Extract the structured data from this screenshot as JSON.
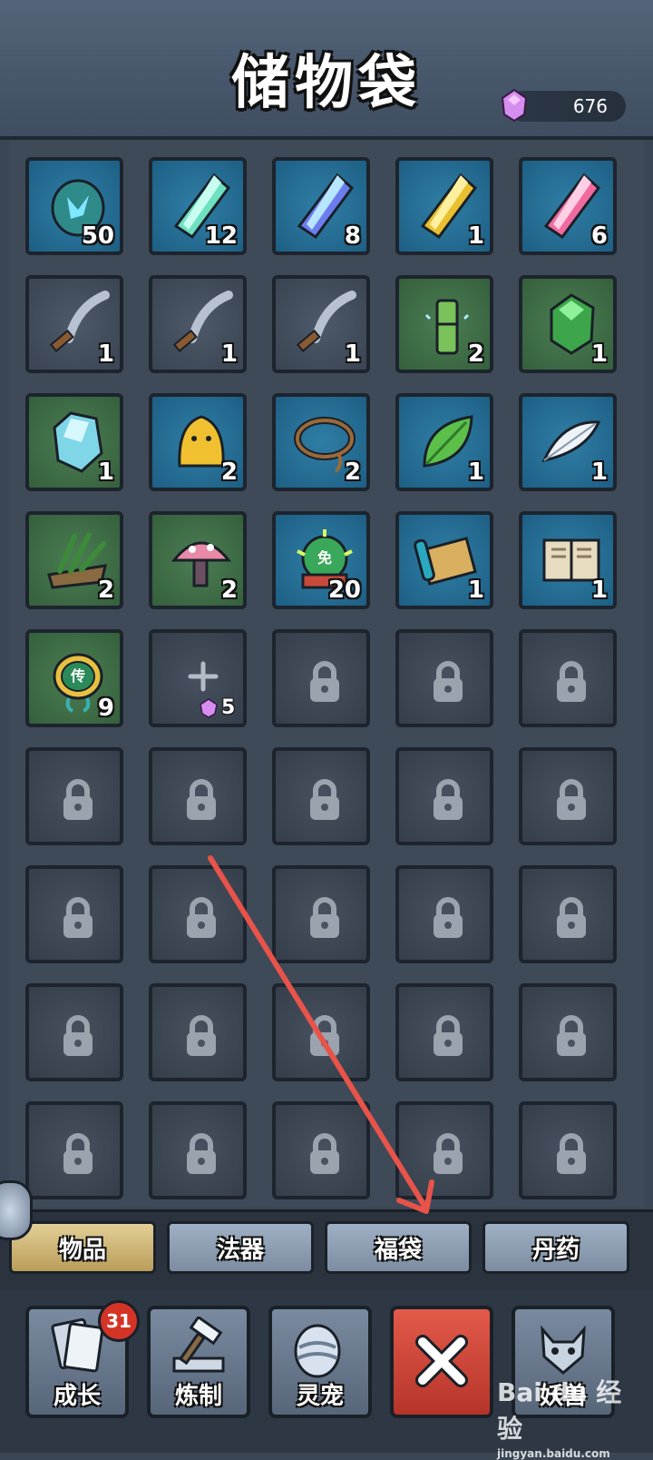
{
  "header": {
    "title": "储物袋",
    "currency_value": "676",
    "currency_icon": "purple-gem-icon"
  },
  "slots": [
    {
      "row": 0,
      "col": 0,
      "bg": "blue",
      "icon": "spirit-stone-icon",
      "count": "50"
    },
    {
      "row": 0,
      "col": 1,
      "bg": "blue",
      "icon": "green-crystal-icon",
      "count": "12"
    },
    {
      "row": 0,
      "col": 2,
      "bg": "blue",
      "icon": "blue-crystal-icon",
      "count": "8"
    },
    {
      "row": 0,
      "col": 3,
      "bg": "blue",
      "icon": "gold-crystal-icon",
      "count": "1"
    },
    {
      "row": 0,
      "col": 4,
      "bg": "blue",
      "icon": "pink-crystal-icon",
      "count": "6"
    },
    {
      "row": 1,
      "col": 0,
      "bg": "gray",
      "icon": "sickle-icon",
      "count": "1"
    },
    {
      "row": 1,
      "col": 1,
      "bg": "gray",
      "icon": "sickle-icon",
      "count": "1"
    },
    {
      "row": 1,
      "col": 2,
      "bg": "gray",
      "icon": "sickle-icon",
      "count": "1"
    },
    {
      "row": 1,
      "col": 3,
      "bg": "green",
      "icon": "bamboo-icon",
      "count": "2"
    },
    {
      "row": 1,
      "col": 4,
      "bg": "green",
      "icon": "jade-stone-icon",
      "count": "1"
    },
    {
      "row": 2,
      "col": 0,
      "bg": "green",
      "icon": "ice-stone-icon",
      "count": "1"
    },
    {
      "row": 2,
      "col": 1,
      "bg": "blue",
      "icon": "yellow-slime-icon",
      "count": "2"
    },
    {
      "row": 2,
      "col": 2,
      "bg": "blue",
      "icon": "rope-icon",
      "count": "2"
    },
    {
      "row": 2,
      "col": 3,
      "bg": "blue",
      "icon": "leaf-icon",
      "count": "1"
    },
    {
      "row": 2,
      "col": 4,
      "bg": "blue",
      "icon": "feather-icon",
      "count": "1"
    },
    {
      "row": 3,
      "col": 0,
      "bg": "green",
      "icon": "herb-bundle-icon",
      "count": "2"
    },
    {
      "row": 3,
      "col": 1,
      "bg": "green",
      "icon": "mushroom-icon",
      "count": "2"
    },
    {
      "row": 3,
      "col": 2,
      "bg": "blue",
      "icon": "exemption-token-icon",
      "count": "20",
      "label": "免"
    },
    {
      "row": 3,
      "col": 3,
      "bg": "blue",
      "icon": "scroll-icon",
      "count": "1"
    },
    {
      "row": 3,
      "col": 4,
      "bg": "blue",
      "icon": "book-icon",
      "count": "1"
    },
    {
      "row": 4,
      "col": 0,
      "bg": "green",
      "icon": "transfer-talisman-icon",
      "count": "9",
      "label": "传"
    }
  ],
  "add_slot": {
    "cost": "5"
  },
  "tabs": [
    {
      "label": "物品",
      "active": true
    },
    {
      "label": "法器",
      "active": false
    },
    {
      "label": "福袋",
      "active": false
    },
    {
      "label": "丹药",
      "active": false
    }
  ],
  "nav": [
    {
      "label": "成长",
      "icon": "cards-icon"
    },
    {
      "label": "炼制",
      "icon": "hammer-anvil-icon"
    },
    {
      "label": "灵宠",
      "icon": "pet-egg-icon"
    },
    {
      "label": "",
      "icon": "close-icon"
    },
    {
      "label": "妖兽",
      "icon": "beast-icon"
    }
  ],
  "nav_badge": "31",
  "watermark": {
    "main": "Bai du 经验",
    "sub": "jingyan.baidu.com"
  },
  "colors": {
    "blue_slot": "#1e5f84",
    "green_slot": "#35603c",
    "gray_slot": "#3a4452",
    "tab_active": "#b99d5a",
    "arrow": "#e8534a"
  }
}
